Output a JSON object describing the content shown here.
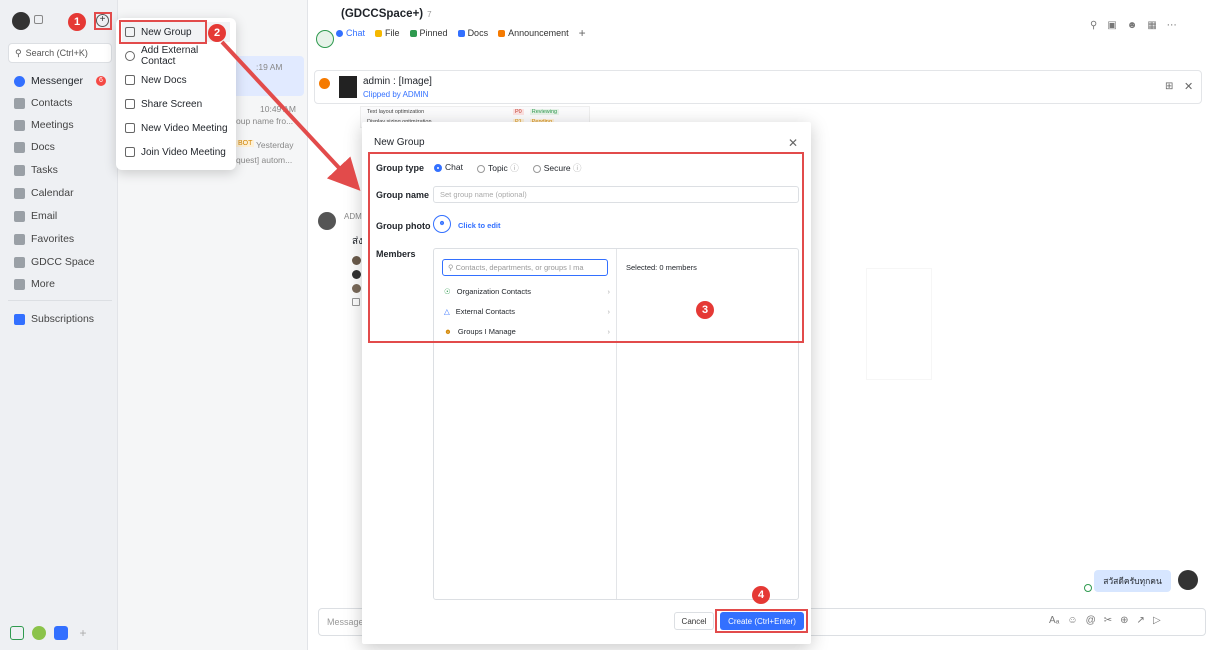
{
  "search": {
    "label": "Search (Ctrl+K)"
  },
  "sidebar": {
    "items": [
      {
        "label": "Messenger",
        "badge": "6"
      },
      {
        "label": "Contacts"
      },
      {
        "label": "Meetings"
      },
      {
        "label": "Docs"
      },
      {
        "label": "Tasks"
      },
      {
        "label": "Calendar"
      },
      {
        "label": "Email"
      },
      {
        "label": "Favorites"
      },
      {
        "label": "GDCC Space"
      },
      {
        "label": "More"
      },
      {
        "label": "Subscriptions"
      }
    ]
  },
  "plus_menu": {
    "items": [
      "New Group",
      "Add External Contact",
      "New Docs",
      "Share Screen",
      "New Video Meeting",
      "Join Video Meeting"
    ]
  },
  "chat_list": {
    "fragments": [
      ":19 AM",
      "10:49 AM",
      "oup name fro...",
      "BOT",
      "Yesterday",
      "quest] autom..."
    ]
  },
  "chat": {
    "title": "(GDCCSpace+)",
    "member_count": "7",
    "tabs": [
      "Chat",
      "File",
      "Pinned",
      "Docs",
      "Announcement",
      "+"
    ],
    "pinned_title": "admin : [Image]",
    "pinned_sub": "Clipped by ADMIN",
    "pinned_rows": [
      {
        "text": "Text layout optimization",
        "tag": "P0",
        "status": "Reviewing"
      },
      {
        "text": "Display sizing optimization",
        "tag": "P1",
        "status": "Pending"
      }
    ],
    "sender_fragment": "ADMI",
    "message_fragment": "ส่ง",
    "my_bubble": "สวัสดีครับทุกคน",
    "input_placeholder": "Message"
  },
  "modal": {
    "title": "New Group",
    "group_type_label": "Group type",
    "types": [
      "Chat",
      "Topic",
      "Secure"
    ],
    "group_name_label": "Group name",
    "group_name_placeholder": "Set group name (optional)",
    "group_photo_label": "Group photo",
    "photo_link": "Click to edit",
    "members_label": "Members",
    "members_search_placeholder": "Contacts, departments, or groups I ma",
    "selected_text": "Selected: 0 members",
    "sources": [
      "Organization Contacts",
      "External Contacts",
      "Groups I Manage"
    ],
    "cancel": "Cancel",
    "create": "Create (Ctrl+Enter)"
  },
  "steps": [
    "1",
    "2",
    "3",
    "4"
  ],
  "colors": {
    "accent": "#3370ff",
    "annotation_red": "#e24b4b"
  }
}
